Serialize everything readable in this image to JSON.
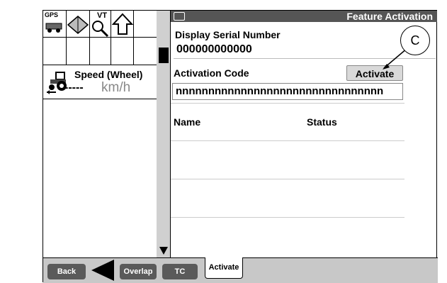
{
  "window": {
    "title": "Feature Activation"
  },
  "icons": {
    "gps": "GPS",
    "vt": "VT"
  },
  "speed": {
    "title": "Speed (Wheel)",
    "value": "-----",
    "unit": "km/h"
  },
  "fields": {
    "serial_label": "Display Serial Number",
    "serial_value": "000000000000",
    "code_label": "Activation Code",
    "code_value": "nnnnnnnnnnnnnnnnnnnnnnnnnnnnnnnn",
    "activate_label": "Activate"
  },
  "table": {
    "columns": [
      "Name",
      "Status"
    ]
  },
  "callout": {
    "label": "C"
  },
  "softkeys": {
    "back": "Back",
    "overlap": "Overlap",
    "tc": "TC",
    "activate_tab": "Activate"
  }
}
